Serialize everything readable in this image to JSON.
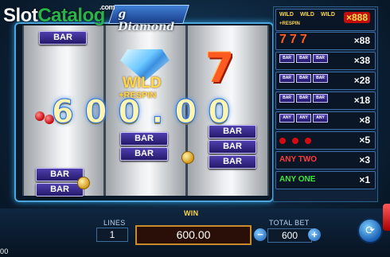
{
  "watermark": {
    "part1": "Slot",
    "part2": "Catalog",
    "part3": ".com"
  },
  "game_logo": "g Diamond",
  "reels": {
    "left_top_bar": "BAR",
    "left_bottom_bars": [
      "BAR",
      "BAR"
    ],
    "middle_bars": [
      "BAR",
      "BAR"
    ],
    "wild_label": "WILD",
    "respin_label": "+RESPIN",
    "right_bars": [
      "BAR",
      "BAR",
      "BAR"
    ],
    "seven_symbol": "7"
  },
  "win_overlay": "600.00",
  "paytable": {
    "header_multiplier": "×888",
    "header_wild": "WILD",
    "header_respin": "+RESPIN",
    "rows": [
      {
        "label": "7 7 7",
        "multiplier": "×88"
      },
      {
        "label": "BAR BAR BAR",
        "multiplier": "×38"
      },
      {
        "label": "BAR BAR",
        "multiplier": "×28"
      },
      {
        "label": "BAR",
        "multiplier": "×18"
      },
      {
        "label": "ANY BAR",
        "multiplier": "×8"
      },
      {
        "label": "cherries",
        "multiplier": "×5"
      },
      {
        "label": "ANY TWO",
        "multiplier": "×3"
      },
      {
        "label": "ANY ONE",
        "multiplier": "×1"
      }
    ]
  },
  "bottom": {
    "lines_label": "LINES",
    "lines_value": "1",
    "win_label": "WIN",
    "win_value": "600.00",
    "total_bet_label": "TOTAL BET",
    "total_bet_value": "600",
    "minus_icon": "−",
    "plus_icon": "+",
    "corner_text": "00"
  }
}
